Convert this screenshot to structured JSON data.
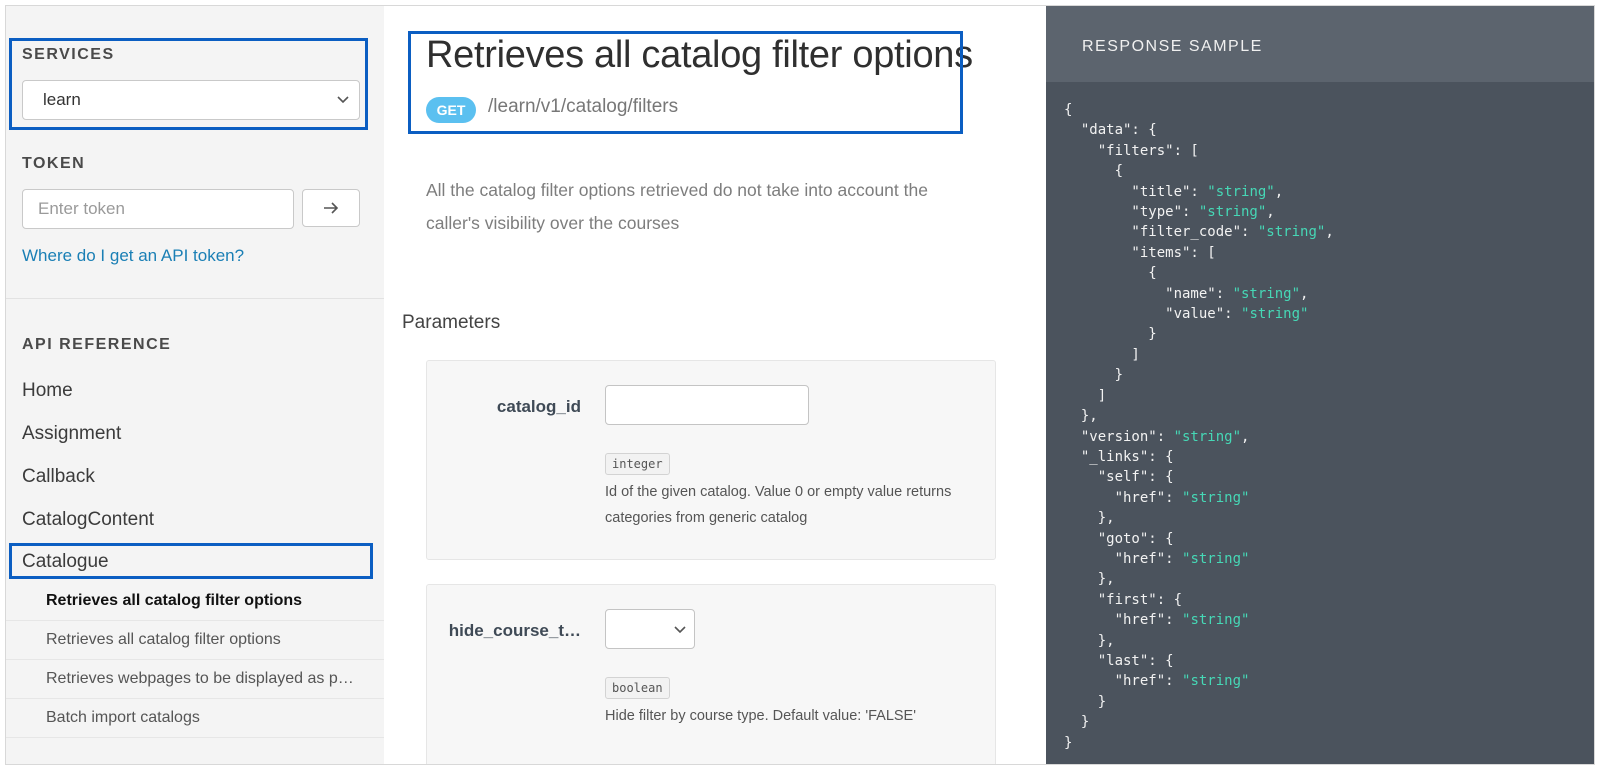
{
  "sidebar": {
    "services_title": "SERVICES",
    "service_selected": "learn",
    "token_title": "TOKEN",
    "token_placeholder": "Enter token",
    "token_link": "Where do I get an API token?",
    "api_reference_title": "API REFERENCE",
    "nav_items": [
      "Home",
      "Assignment",
      "Callback",
      "CatalogContent",
      "Catalogue"
    ],
    "sub_items": [
      "Retrieves all catalog filter options",
      "Retrieves all catalog filter options",
      "Retrieves webpages to be displayed as p…",
      "Batch import catalogs"
    ]
  },
  "main": {
    "title": "Retrieves all catalog filter options",
    "method": "GET",
    "path": "/learn/v1/catalog/filters",
    "description": "All the catalog filter options retrieved do not take into account the caller's visibility over the courses",
    "parameters_title": "Parameters",
    "params": [
      {
        "name": "catalog_id",
        "type": "integer",
        "description": "Id of the given catalog. Value 0 or empty value returns categories from generic catalog"
      },
      {
        "name": "hide_course_t…",
        "type": "boolean",
        "description": "Hide filter by course type. Default value: 'FALSE'"
      }
    ]
  },
  "response": {
    "title": "RESPONSE SAMPLE",
    "code_lines": [
      [
        "{"
      ],
      [
        "  \"data\": {"
      ],
      [
        "    \"filters\": ["
      ],
      [
        "      {"
      ],
      [
        "        \"title\": ",
        "\"string\"",
        ","
      ],
      [
        "        \"type\": ",
        "\"string\"",
        ","
      ],
      [
        "        \"filter_code\": ",
        "\"string\"",
        ","
      ],
      [
        "        \"items\": ["
      ],
      [
        "          {"
      ],
      [
        "            \"name\": ",
        "\"string\"",
        ","
      ],
      [
        "            \"value\": ",
        "\"string\"",
        ""
      ],
      [
        "          }"
      ],
      [
        "        ]"
      ],
      [
        "      }"
      ],
      [
        "    ]"
      ],
      [
        "  },"
      ],
      [
        "  \"version\": ",
        "\"string\"",
        ","
      ],
      [
        "  \"_links\": {"
      ],
      [
        "    \"self\": {"
      ],
      [
        "      \"href\": ",
        "\"string\"",
        ""
      ],
      [
        "    },"
      ],
      [
        "    \"goto\": {"
      ],
      [
        "      \"href\": ",
        "\"string\"",
        ""
      ],
      [
        "    },"
      ],
      [
        "    \"first\": {"
      ],
      [
        "      \"href\": ",
        "\"string\"",
        ""
      ],
      [
        "    },"
      ],
      [
        "    \"last\": {"
      ],
      [
        "      \"href\": ",
        "\"string\"",
        ""
      ],
      [
        "    }"
      ],
      [
        "  }"
      ],
      [
        "}"
      ]
    ]
  },
  "colors": {
    "highlight": "#0b5ec2",
    "method_badge": "#5bc0f0",
    "link": "#1a7fb5",
    "code_bg": "#4b535d",
    "code_string": "#46d8b6"
  },
  "icons": {
    "select_chevron": "chevron-down-icon",
    "token_submit": "arrow-right-icon"
  }
}
